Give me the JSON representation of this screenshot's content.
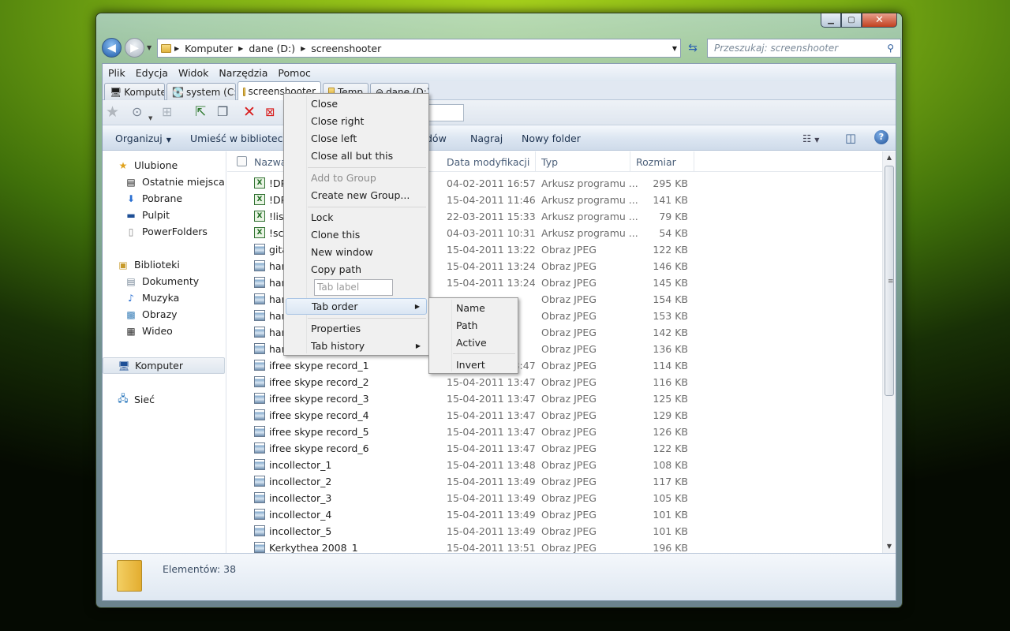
{
  "window": {
    "min_icon": "minimize-icon",
    "max_icon": "maximize-icon",
    "close_icon": "close-icon"
  },
  "address": {
    "segments": [
      "Komputer",
      "dane (D:)",
      "screenshooter"
    ]
  },
  "search": {
    "placeholder": "Przeszukaj: screenshooter"
  },
  "menubar": [
    "Plik",
    "Edycja",
    "Widok",
    "Narzędzia",
    "Pomoc"
  ],
  "tabs": [
    {
      "label": "Komputer"
    },
    {
      "label": "system (C:)"
    },
    {
      "label": "screenshooter",
      "active": true
    },
    {
      "label": "Temp"
    },
    {
      "label": "dane (D:)"
    }
  ],
  "commands": {
    "organize": "Organizuj",
    "library": "Umieść w bibliotece",
    "share_tail": "dów",
    "burn": "Nagraj",
    "new_folder": "Nowy folder"
  },
  "nav": {
    "favorites": "Ulubione",
    "recent": "Ostatnie miejsca",
    "downloads": "Pobrane",
    "desktop": "Pulpit",
    "powerfolders": "PowerFolders",
    "libraries": "Biblioteki",
    "documents": "Dokumenty",
    "music": "Muzyka",
    "pictures": "Obrazy",
    "video": "Wideo",
    "computer": "Komputer",
    "network": "Sieć"
  },
  "columns": {
    "name": "Nazwa",
    "date": "Data modyfikacji",
    "type": "Typ",
    "size": "Rozmiar"
  },
  "files": [
    {
      "name": "!DP",
      "date": "04-02-2011 16:57",
      "type": "Arkusz programu ...",
      "size": "295 KB",
      "icon": "xls"
    },
    {
      "name": "!DP",
      "date": "15-04-2011 11:46",
      "type": "Arkusz programu ...",
      "size": "141 KB",
      "icon": "xls"
    },
    {
      "name": "!list",
      "date": "22-03-2011 15:33",
      "type": "Arkusz programu ...",
      "size": "79 KB",
      "icon": "xls"
    },
    {
      "name": "!scr",
      "date": "04-03-2011 10:31",
      "type": "Arkusz programu ...",
      "size": "54 KB",
      "icon": "xls"
    },
    {
      "name": "gita",
      "date": "15-04-2011 13:22",
      "type": "Obraz JPEG",
      "size": "122 KB",
      "icon": "jpg"
    },
    {
      "name": "han",
      "date": "15-04-2011 13:24",
      "type": "Obraz JPEG",
      "size": "146 KB",
      "icon": "jpg"
    },
    {
      "name": "han",
      "date": "15-04-2011 13:24",
      "type": "Obraz JPEG",
      "size": "145 KB",
      "icon": "jpg"
    },
    {
      "name": "han",
      "date": "",
      "type": "Obraz JPEG",
      "size": "154 KB",
      "icon": "jpg"
    },
    {
      "name": "han",
      "date": "",
      "type": "Obraz JPEG",
      "size": "153 KB",
      "icon": "jpg"
    },
    {
      "name": "han",
      "date": "",
      "type": "Obraz JPEG",
      "size": "142 KB",
      "icon": "jpg"
    },
    {
      "name": "han",
      "date": "",
      "type": "Obraz JPEG",
      "size": "136 KB",
      "icon": "jpg"
    },
    {
      "name": "ifree skype record_1",
      "date": "15-04-2011 13:47",
      "type": "Obraz JPEG",
      "size": "114 KB",
      "icon": "jpg"
    },
    {
      "name": "ifree skype record_2",
      "date": "15-04-2011 13:47",
      "type": "Obraz JPEG",
      "size": "116 KB",
      "icon": "jpg"
    },
    {
      "name": "ifree skype record_3",
      "date": "15-04-2011 13:47",
      "type": "Obraz JPEG",
      "size": "125 KB",
      "icon": "jpg"
    },
    {
      "name": "ifree skype record_4",
      "date": "15-04-2011 13:47",
      "type": "Obraz JPEG",
      "size": "129 KB",
      "icon": "jpg"
    },
    {
      "name": "ifree skype record_5",
      "date": "15-04-2011 13:47",
      "type": "Obraz JPEG",
      "size": "126 KB",
      "icon": "jpg"
    },
    {
      "name": "ifree skype record_6",
      "date": "15-04-2011 13:47",
      "type": "Obraz JPEG",
      "size": "122 KB",
      "icon": "jpg"
    },
    {
      "name": "incollector_1",
      "date": "15-04-2011 13:48",
      "type": "Obraz JPEG",
      "size": "108 KB",
      "icon": "jpg"
    },
    {
      "name": "incollector_2",
      "date": "15-04-2011 13:49",
      "type": "Obraz JPEG",
      "size": "117 KB",
      "icon": "jpg"
    },
    {
      "name": "incollector_3",
      "date": "15-04-2011 13:49",
      "type": "Obraz JPEG",
      "size": "105 KB",
      "icon": "jpg"
    },
    {
      "name": "incollector_4",
      "date": "15-04-2011 13:49",
      "type": "Obraz JPEG",
      "size": "101 KB",
      "icon": "jpg"
    },
    {
      "name": "incollector_5",
      "date": "15-04-2011 13:49",
      "type": "Obraz JPEG",
      "size": "101 KB",
      "icon": "jpg"
    },
    {
      "name": "Kerkythea 2008_1",
      "date": "15-04-2011 13:51",
      "type": "Obraz JPEG",
      "size": "196 KB",
      "icon": "jpg"
    }
  ],
  "status": {
    "count": "Elementów: 38"
  },
  "context_menu": {
    "close": "Close",
    "close_right": "Close right",
    "close_left": "Close left",
    "close_all_but": "Close all but this",
    "add_group": "Add to Group",
    "new_group": "Create new Group...",
    "lock": "Lock",
    "clone": "Clone this",
    "new_window": "New window",
    "copy_path": "Copy path",
    "tab_label_placeholder": "Tab label",
    "tab_order": "Tab order",
    "properties": "Properties",
    "tab_history": "Tab history"
  },
  "submenu": {
    "name": "Name",
    "path": "Path",
    "active": "Active",
    "invert": "Invert"
  }
}
